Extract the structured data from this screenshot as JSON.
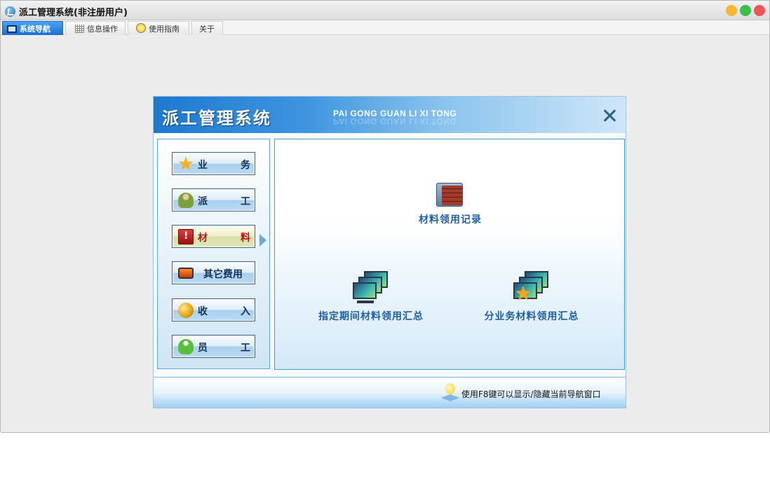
{
  "window": {
    "title": "派工管理系统(非注册用户)"
  },
  "tabs": [
    {
      "label": "系统导航",
      "icon": "monitor-icon"
    },
    {
      "label": "信息操作",
      "icon": "grid-icon"
    },
    {
      "label": "使用指南",
      "icon": "bulb-icon"
    },
    {
      "label": "关于"
    }
  ],
  "panel": {
    "title": "派工管理系统",
    "subtitle": "PAI GONG GUAN LI XI TONG"
  },
  "nav": {
    "items": [
      {
        "label": "业务",
        "icon": "star-icon"
      },
      {
        "label": "派工",
        "icon": "worker-icon"
      },
      {
        "label": "材料",
        "icon": "alert-monitor-icon",
        "active": true
      },
      {
        "label": "其它费用",
        "icon": "tv-icon"
      },
      {
        "label": "收入",
        "icon": "coins-icon"
      },
      {
        "label": "员工",
        "icon": "users-icon"
      }
    ]
  },
  "content": {
    "items": [
      {
        "label": "材料领用记录",
        "icon": "brick-folder-icon"
      },
      {
        "label": "指定期间材料领用汇总",
        "icon": "monitors-icon"
      },
      {
        "label": "分业务材料领用汇总",
        "icon": "monitors-star-icon"
      }
    ]
  },
  "footer": {
    "hint": "使用F8键可以显示/隐藏当前导航窗口"
  },
  "colors": {
    "accent": "#1e78cf",
    "active_text": "#b3151d",
    "label_blue": "#1f5fa8"
  }
}
